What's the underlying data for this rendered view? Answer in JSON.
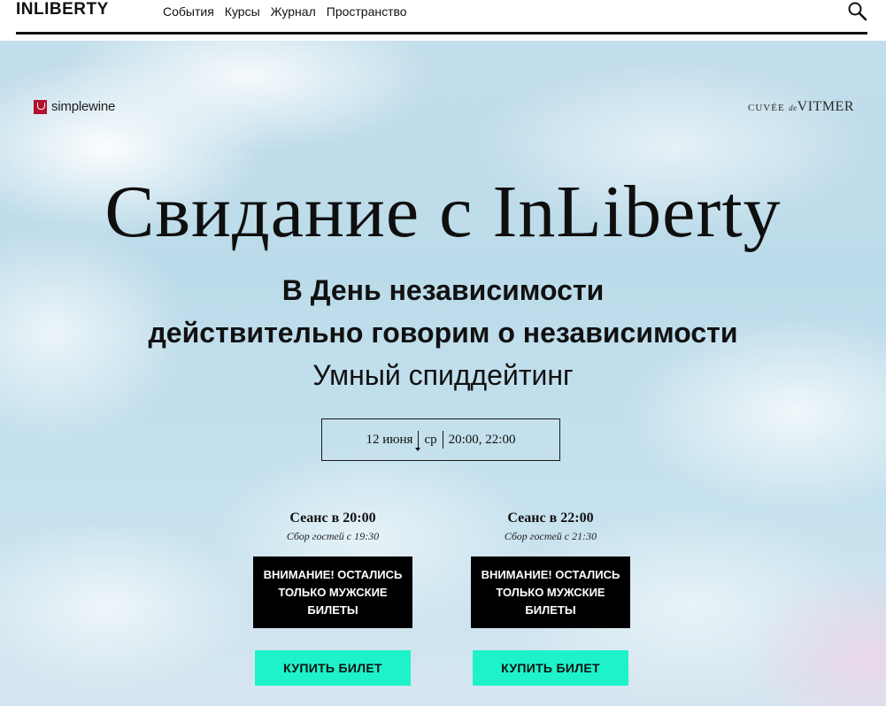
{
  "header": {
    "logo": "INLIBERTY",
    "nav": [
      {
        "label": "События"
      },
      {
        "label": "Курсы"
      },
      {
        "label": "Журнал"
      },
      {
        "label": "Пространство"
      }
    ],
    "search_icon": "search-icon"
  },
  "hero": {
    "sponsor_left": {
      "brand": "simplewine"
    },
    "sponsor_right": {
      "prefix": "CUVÉE",
      "de": "de",
      "name": "VITMER"
    },
    "title": "Свидание с InLiberty",
    "subtitle_line1": "В День независимости",
    "subtitle_line2": "действительно говорим о независимости",
    "subtitle_line3": "Умный спиддейтинг",
    "date": {
      "day": "12 июня",
      "weekday": "ср",
      "times": "20:00, 22:00"
    },
    "sessions": [
      {
        "title": "Сеанс в 20:00",
        "note": "Сбор гостей с 19:30",
        "warning": "ВНИМАНИЕ! ОСТАЛИСЬ ТОЛЬКО МУЖСКИЕ БИЛЕТЫ",
        "button": "КУПИТЬ БИЛЕТ"
      },
      {
        "title": "Сеанс в 22:00",
        "note": "Сбор гостей с 21:30",
        "warning": "ВНИМАНИЕ! ОСТАЛИСЬ ТОЛЬКО МУЖСКИЕ БИЛЕТЫ",
        "button": "КУПИТЬ БИЛЕТ"
      }
    ]
  },
  "colors": {
    "accent": "#1ef2c9",
    "text": "#111111",
    "warning_bg": "#000000",
    "sponsor_red": "#b3112e"
  }
}
